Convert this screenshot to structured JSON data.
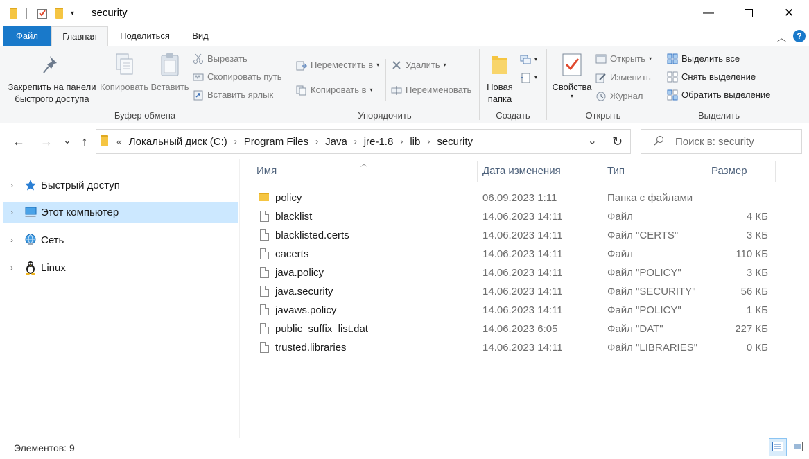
{
  "window": {
    "title": "security",
    "minimize": "—",
    "maximize": "☐",
    "close": "✕"
  },
  "quick_access": {
    "dropdown": "▾"
  },
  "ribbon_tabs": [
    "Файл",
    "Главная",
    "Поделиться",
    "Вид"
  ],
  "ribbon": {
    "clipboard": {
      "label": "Буфер обмена",
      "pin_label_1": "Закрепить на панели",
      "pin_label_2": "быстрого доступа",
      "copy": "Копировать",
      "paste": "Вставить",
      "cut": "Вырезать",
      "copy_path": "Скопировать путь",
      "paste_shortcut": "Вставить ярлык"
    },
    "organize": {
      "label": "Упорядочить",
      "move_to": "Переместить в",
      "copy_to": "Копировать в",
      "delete": "Удалить",
      "rename": "Переименовать"
    },
    "new": {
      "label": "Создать",
      "new_folder_1": "Новая",
      "new_folder_2": "папка"
    },
    "open": {
      "label": "Открыть",
      "properties": "Свойства",
      "open": "Открыть",
      "edit": "Изменить",
      "history": "Журнал"
    },
    "select": {
      "label": "Выделить",
      "select_all": "Выделить все",
      "select_none": "Снять выделение",
      "invert": "Обратить выделение"
    }
  },
  "nav": {
    "back": "←",
    "forward": "→",
    "recent": "⌄",
    "up": "↑",
    "refresh": "↻"
  },
  "address": {
    "overflow": "«",
    "crumbs": [
      "Локальный диск (C:)",
      "Program Files",
      "Java",
      "jre-1.8",
      "lib",
      "security"
    ],
    "dropdown": "⌄"
  },
  "search": {
    "placeholder": "Поиск в: security"
  },
  "navpane": [
    {
      "label": "Быстрый доступ",
      "icon": "star-icon",
      "selected": false
    },
    {
      "label": "Этот компьютер",
      "icon": "computer-icon",
      "selected": true
    },
    {
      "label": "Сеть",
      "icon": "network-icon",
      "selected": false
    },
    {
      "label": "Linux",
      "icon": "linux-penguin-icon",
      "selected": false
    }
  ],
  "columns": {
    "name": "Имя",
    "date": "Дата изменения",
    "type": "Тип",
    "size": "Размер"
  },
  "files": [
    {
      "name": "policy",
      "date": "06.09.2023 1:11",
      "type": "Папка с файлами",
      "size": "",
      "kind": "folder"
    },
    {
      "name": "blacklist",
      "date": "14.06.2023 14:11",
      "type": "Файл",
      "size": "4 КБ",
      "kind": "file"
    },
    {
      "name": "blacklisted.certs",
      "date": "14.06.2023 14:11",
      "type": "Файл \"CERTS\"",
      "size": "3 КБ",
      "kind": "file"
    },
    {
      "name": "cacerts",
      "date": "14.06.2023 14:11",
      "type": "Файл",
      "size": "110 КБ",
      "kind": "file"
    },
    {
      "name": "java.policy",
      "date": "14.06.2023 14:11",
      "type": "Файл \"POLICY\"",
      "size": "3 КБ",
      "kind": "file"
    },
    {
      "name": "java.security",
      "date": "14.06.2023 14:11",
      "type": "Файл \"SECURITY\"",
      "size": "56 КБ",
      "kind": "file"
    },
    {
      "name": "javaws.policy",
      "date": "14.06.2023 14:11",
      "type": "Файл \"POLICY\"",
      "size": "1 КБ",
      "kind": "file"
    },
    {
      "name": "public_suffix_list.dat",
      "date": "14.06.2023 6:05",
      "type": "Файл \"DAT\"",
      "size": "227 КБ",
      "kind": "file"
    },
    {
      "name": "trusted.libraries",
      "date": "14.06.2023 14:11",
      "type": "Файл \"LIBRARIES\"",
      "size": "0 КБ",
      "kind": "file"
    }
  ],
  "status": {
    "items": "Элементов: 9"
  },
  "colors": {
    "accent": "#1979ca",
    "selection": "#cce8ff",
    "folder": "#f5c542"
  }
}
